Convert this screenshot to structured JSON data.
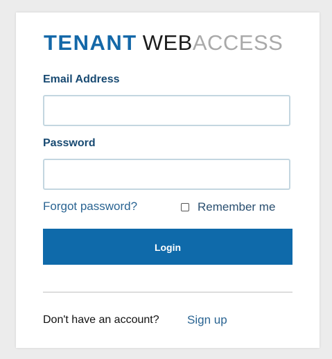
{
  "logo": {
    "part1": "TENANT",
    "part2": "WEB",
    "part3": "ACCESS"
  },
  "form": {
    "email_label": "Email Address",
    "email_value": "",
    "email_placeholder": "",
    "password_label": "Password",
    "password_value": "",
    "password_placeholder": "",
    "forgot_password_link": "Forgot password?",
    "remember_me_label": "Remember me",
    "remember_me_checked": false,
    "login_button": "Login"
  },
  "footer": {
    "no_account_text": "Don't have an account?",
    "signup_link": "Sign up"
  },
  "colors": {
    "brand_blue": "#1468a8",
    "button_blue": "#0f6aaa",
    "label_blue": "#184a72",
    "link_blue": "#2a6492",
    "logo_gray": "#a9a9a9",
    "background": "#ececec"
  }
}
